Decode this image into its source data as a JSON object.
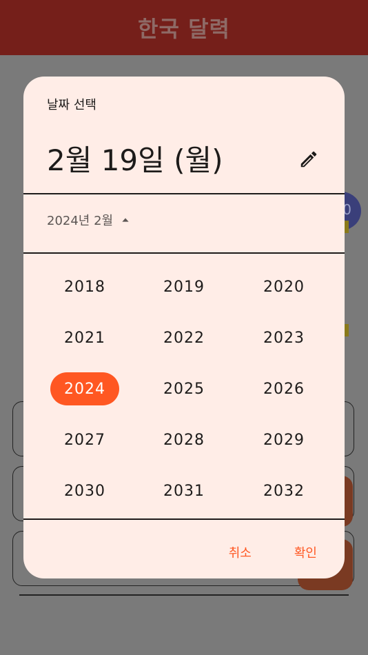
{
  "app": {
    "title": "한국 달력"
  },
  "background": {
    "avatar_text": "0"
  },
  "dialog": {
    "helper_text": "날짜 선택",
    "headline": "2월 19일 (월)",
    "edit_icon": "pencil-icon",
    "month_selector": {
      "label": "2024년 2월",
      "icon": "arrow-drop-up-icon"
    },
    "years": [
      "2018",
      "2019",
      "2020",
      "2021",
      "2022",
      "2023",
      "2024",
      "2025",
      "2026",
      "2027",
      "2028",
      "2029",
      "2030",
      "2031",
      "2032"
    ],
    "selected_year": "2024",
    "cancel_label": "취소",
    "confirm_label": "확인"
  },
  "colors": {
    "appbar": "#751f1a",
    "dialog_background": "#ffede7",
    "accent": "#ff5722",
    "scrim": "#7a7a7a"
  }
}
